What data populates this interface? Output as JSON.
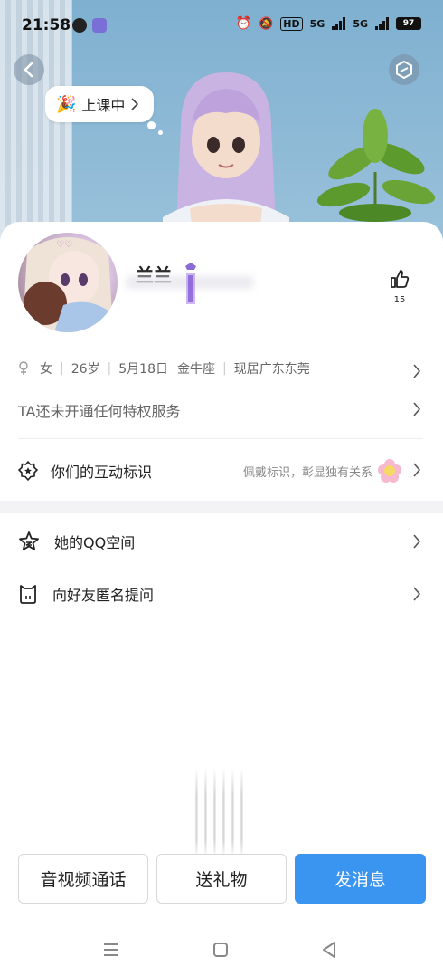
{
  "status_bar": {
    "time": "21:58",
    "network_a": "5G",
    "network_b": "5G",
    "hd_label": "HD",
    "battery": "97"
  },
  "hero": {
    "status_label": "上课中"
  },
  "profile": {
    "nickname": "兰兰",
    "likes": "15"
  },
  "info": {
    "gender": "女",
    "age": "26岁",
    "birthday": "5月18日",
    "zodiac": "金牛座",
    "location": "现居广东东莞"
  },
  "privilege": {
    "text": "TA还未开通任何特权服务"
  },
  "interaction": {
    "title": "你们的互动标识",
    "hint": "佩戴标识，彰显独有关系"
  },
  "list": [
    {
      "title": "她的QQ空间"
    },
    {
      "title": "向好友匿名提问"
    }
  ],
  "actions": {
    "call": "音视频通话",
    "gift": "送礼物",
    "message": "发消息"
  },
  "colors": {
    "accent": "#3a95f0"
  }
}
